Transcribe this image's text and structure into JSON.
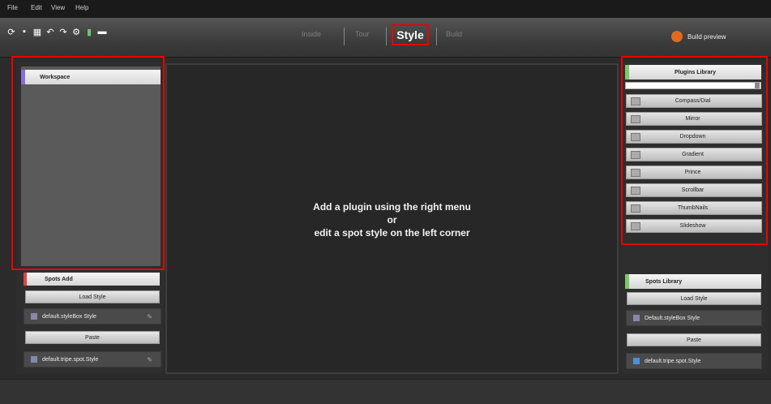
{
  "menu": [
    "File",
    "Edit",
    "View",
    "Help"
  ],
  "toolbar": {
    "icons": [
      "refresh-icon",
      "save-icon",
      "grid-icon",
      "undo-icon",
      "redo-icon",
      "settings-icon",
      "export-icon",
      "screen-icon"
    ],
    "tabs": [
      "Inside",
      "Tour",
      "Style",
      "Build"
    ],
    "active_tab": "Style",
    "preview_label": "Build preview"
  },
  "left": {
    "workspace_header": "Workspace",
    "spots_header": "Spots Add",
    "new_style_btn": "Load Style",
    "item1": "default.styleBox Style",
    "paste_btn": "Paste",
    "item2": "default.tripe.spot.Style"
  },
  "canvas": {
    "line1": "Add a plugin using the right menu",
    "line2": "or",
    "line3": "edit a spot style on the left corner"
  },
  "right": {
    "plugins_header": "Plugins Library",
    "plugins": [
      "Compass/Dial",
      "Mirror",
      "Dropdown",
      "Gradient",
      "Prince",
      "Scrollbar",
      "ThumbNails",
      "Slideshow"
    ],
    "spots_header": "Spots Library",
    "load_btn": "Load Style",
    "item1": "Default.styleBox Style",
    "paste_btn": "Paste",
    "item2": "default.tripe.spot.Style"
  },
  "colors": {
    "highlight": "#e00000",
    "accent_green": "#7bc96b",
    "accent_purple": "#8a6fd8",
    "accent_red": "#d44444",
    "preview_orange": "#e06a20"
  }
}
